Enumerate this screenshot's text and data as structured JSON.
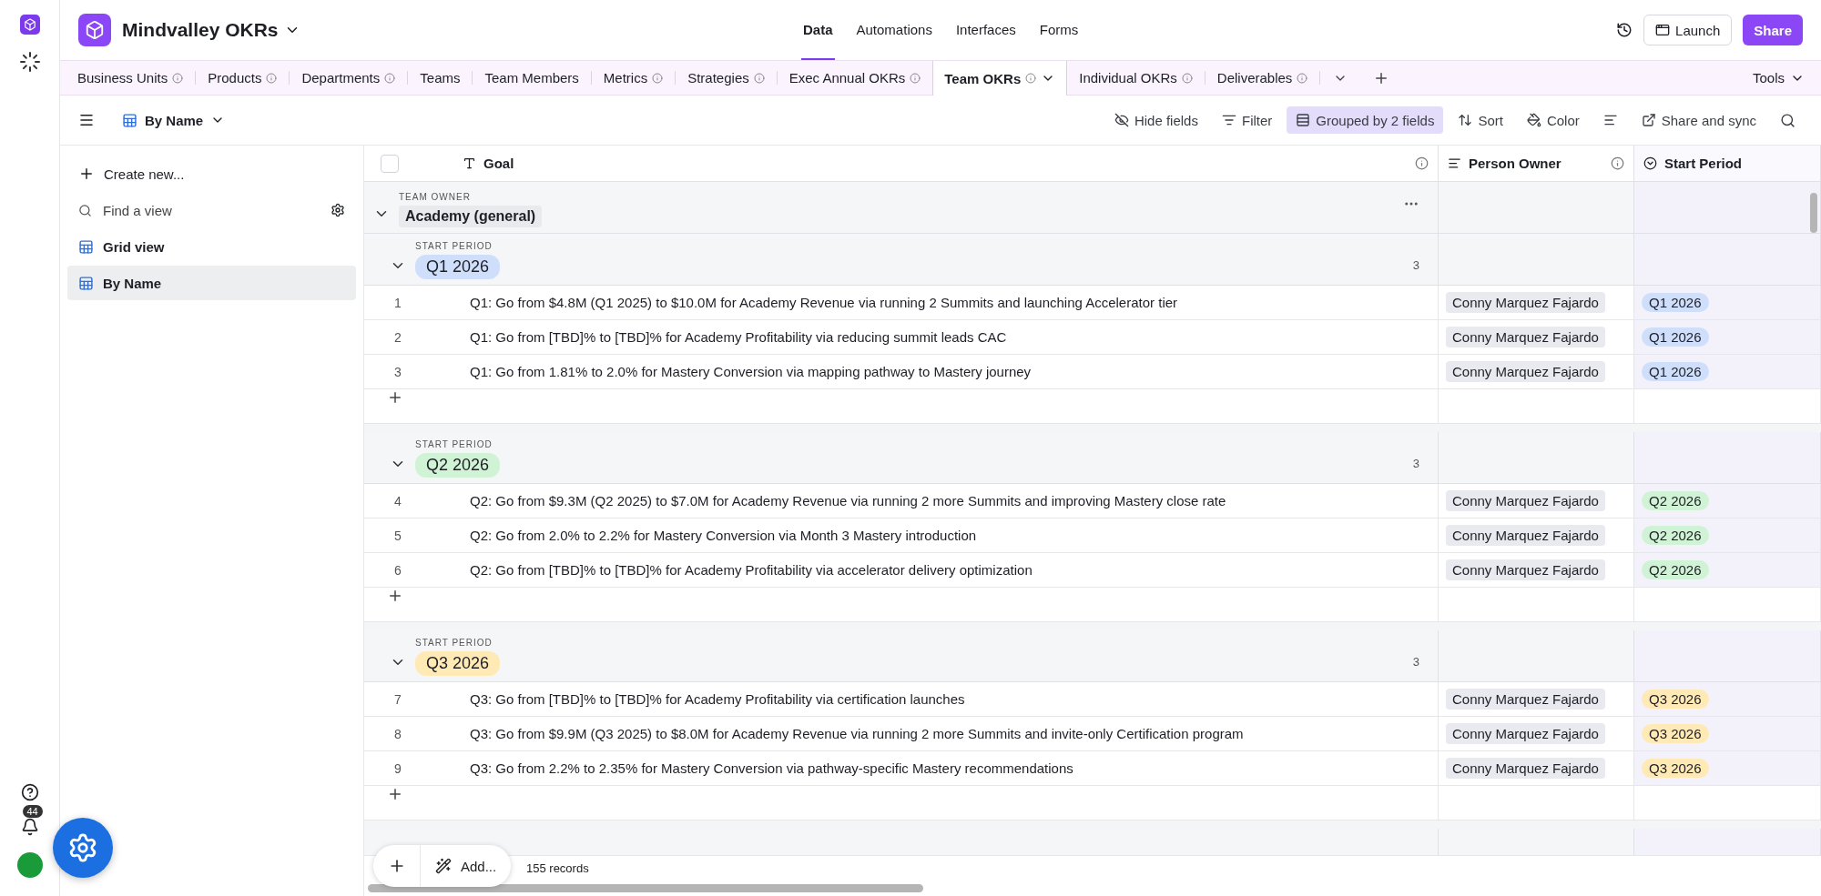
{
  "app": {
    "title": "Mindvalley OKRs"
  },
  "nav": [
    {
      "label": "Data",
      "selected": true
    },
    {
      "label": "Automations",
      "selected": false
    },
    {
      "label": "Interfaces",
      "selected": false
    },
    {
      "label": "Forms",
      "selected": false
    }
  ],
  "header_actions": {
    "launch": "Launch",
    "share": "Share"
  },
  "rail": {
    "notification_count": "44"
  },
  "tables": [
    {
      "label": "Business Units",
      "info": true,
      "selected": false
    },
    {
      "label": "Products",
      "info": true,
      "selected": false
    },
    {
      "label": "Departments",
      "info": true,
      "selected": false
    },
    {
      "label": "Teams",
      "info": false,
      "selected": false
    },
    {
      "label": "Team Members",
      "info": false,
      "selected": false
    },
    {
      "label": "Metrics",
      "info": true,
      "selected": false
    },
    {
      "label": "Strategies",
      "info": true,
      "selected": false
    },
    {
      "label": "Exec Annual OKRs",
      "info": true,
      "selected": false
    },
    {
      "label": "Team OKRs",
      "info": true,
      "selected": true
    },
    {
      "label": "Individual OKRs",
      "info": true,
      "selected": false
    },
    {
      "label": "Deliverables",
      "info": true,
      "selected": false
    }
  ],
  "tools": "Tools",
  "view": {
    "name": "By Name"
  },
  "toolbar": [
    {
      "kind": "hide",
      "label": "Hide fields",
      "active": false
    },
    {
      "kind": "filter",
      "label": "Filter",
      "active": false
    },
    {
      "kind": "group",
      "label": "Grouped by 2 fields",
      "active": true
    },
    {
      "kind": "sort",
      "label": "Sort",
      "active": false
    },
    {
      "kind": "color",
      "label": "Color",
      "active": false
    },
    {
      "kind": "row_height",
      "active": false
    },
    {
      "kind": "share",
      "label": "Share and sync",
      "active": false
    }
  ],
  "sidebar": {
    "create": "Create new...",
    "search_placeholder": "Find a view",
    "views": [
      {
        "label": "Grid view",
        "selected": false
      },
      {
        "label": "By Name",
        "selected": true
      }
    ]
  },
  "grid": {
    "select_all": {
      "checked": false
    },
    "columns": [
      {
        "kind": "text",
        "label": "Goal",
        "info": true
      },
      {
        "kind": "person",
        "label": "Person Owner",
        "info": true
      },
      {
        "kind": "select",
        "label": "Start Period",
        "info": false
      }
    ],
    "group": {
      "field": "TEAM OWNER",
      "value": "Academy (general)",
      "expanded": true
    },
    "subgroups": [
      {
        "field": "START PERIOD",
        "value": "Q1 2026",
        "color": "#cfdffb",
        "count": "3",
        "expanded": true,
        "rows": [
          {
            "number": "1",
            "goal": "Q1: Go from $4.8M (Q1 2025) to $10.0M for Academy Revenue via running 2 Summits and launching Accelerator tier",
            "owner": "Conny Marquez Fajardo",
            "period": "Q1 2026"
          },
          {
            "number": "2",
            "goal": "Q1: Go from [TBD]% to [TBD]% for Academy Profitability via reducing summit leads CAC",
            "owner": "Conny Marquez Fajardo",
            "period": "Q1 2026"
          },
          {
            "number": "3",
            "goal": "Q1: Go from 1.81% to 2.0% for Mastery Conversion via mapping pathway to Mastery journey",
            "owner": "Conny Marquez Fajardo",
            "period": "Q1 2026"
          }
        ]
      },
      {
        "field": "START PERIOD",
        "value": "Q2 2026",
        "color": "#d1f3d5",
        "count": "3",
        "expanded": true,
        "rows": [
          {
            "number": "4",
            "goal": "Q2: Go from $9.3M (Q2 2025) to $7.0M for Academy Revenue via running 2 more Summits and improving Mastery close rate",
            "owner": "Conny Marquez Fajardo",
            "period": "Q2 2026"
          },
          {
            "number": "5",
            "goal": "Q2: Go from 2.0% to 2.2% for Mastery Conversion via Month 3 Mastery introduction",
            "owner": "Conny Marquez Fajardo",
            "period": "Q2 2026"
          },
          {
            "number": "6",
            "goal": "Q2: Go from [TBD]% to [TBD]% for Academy Profitability via accelerator delivery optimization",
            "owner": "Conny Marquez Fajardo",
            "period": "Q2 2026"
          }
        ]
      },
      {
        "field": "START PERIOD",
        "value": "Q3 2026",
        "color": "#ffe9b5",
        "count": "3",
        "expanded": true,
        "rows": [
          {
            "number": "7",
            "goal": "Q3: Go from [TBD]% to [TBD]% for Academy Profitability via certification launches",
            "owner": "Conny Marquez Fajardo",
            "period": "Q3 2026"
          },
          {
            "number": "8",
            "goal": "Q3: Go from $9.9M (Q3 2025) to $8.0M for Academy Revenue via running 2 more Summits and invite-only Certification program",
            "owner": "Conny Marquez Fajardo",
            "period": "Q3 2026"
          },
          {
            "number": "9",
            "goal": "Q3: Go from 2.2% to 2.35% for Mastery Conversion via pathway-specific Mastery recommendations",
            "owner": "Conny Marquez Fajardo",
            "period": "Q3 2026"
          }
        ]
      }
    ]
  },
  "footer": {
    "add": "Add...",
    "records": "155 records"
  }
}
